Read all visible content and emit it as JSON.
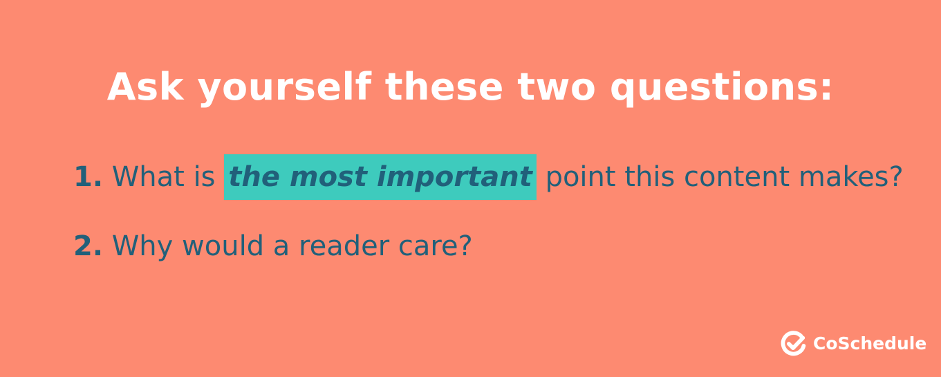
{
  "colors": {
    "background": "#fd8a71",
    "text_white": "#ffffff",
    "text_dark": "#21607a",
    "highlight": "#3ecbbd"
  },
  "title": "Ask yourself these two questions:",
  "questions": [
    {
      "number": "1.",
      "before": "What is",
      "highlight": "the most important",
      "after": "point this content makes?"
    },
    {
      "number": "2.",
      "text": "Why would a reader care?"
    }
  ],
  "brand": {
    "icon": "checkmark-circle-icon",
    "name": "CoSchedule"
  }
}
